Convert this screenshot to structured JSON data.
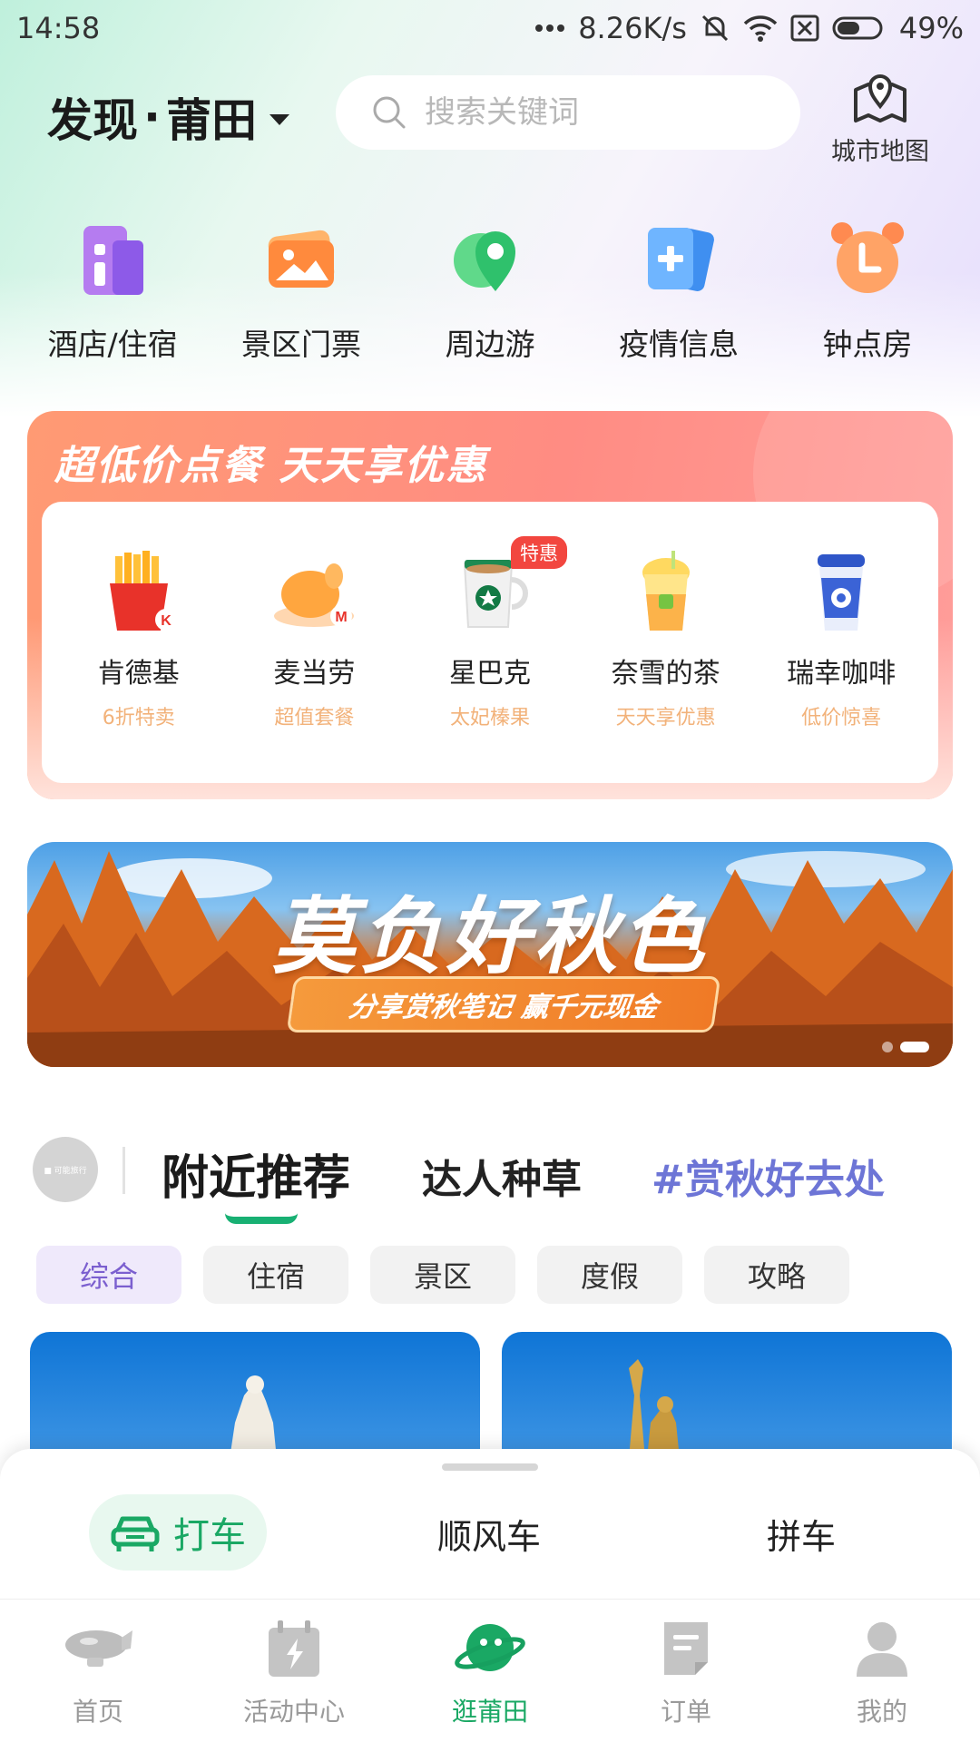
{
  "status_bar": {
    "time": "14:58",
    "net_speed": "8.26K/s",
    "battery": "49%"
  },
  "header": {
    "title_prefix": "发现",
    "title_sep": "·",
    "city": "莆田",
    "search_placeholder": "搜索关键词",
    "city_map_label": "城市地图"
  },
  "quick_nav": [
    {
      "label": "酒店/住宿",
      "icon": "hotel-icon"
    },
    {
      "label": "景区门票",
      "icon": "ticket-icon"
    },
    {
      "label": "周边游",
      "icon": "map-pin-icon"
    },
    {
      "label": "疫情信息",
      "icon": "health-info-icon"
    },
    {
      "label": "钟点房",
      "icon": "alarm-clock-icon"
    }
  ],
  "food": {
    "title": "超低价点餐 天天享优惠",
    "special_tag": "特惠",
    "items": [
      {
        "name": "肯德基",
        "sub": "6折特卖",
        "icon": "kfc-fries-icon"
      },
      {
        "name": "麦当劳",
        "sub": "超值套餐",
        "icon": "mcd-chicken-icon"
      },
      {
        "name": "星巴克",
        "sub": "太妃榛果",
        "icon": "starbucks-cup-icon"
      },
      {
        "name": "奈雪的茶",
        "sub": "天天享优惠",
        "icon": "nayuki-tea-icon"
      },
      {
        "name": "瑞幸咖啡",
        "sub": "低价惊喜",
        "icon": "luckin-coffee-icon"
      }
    ]
  },
  "banner": {
    "title": "莫负好秋色",
    "subtitle": "分享赏秋笔记 赢千元现金"
  },
  "rec_tabs": {
    "avatar_text": "■ 可能旅行",
    "active": "附近推荐",
    "second": "达人种草",
    "third": "#赏秋好去处"
  },
  "chips": [
    "综合",
    "住宿",
    "景区",
    "度假",
    "攻略"
  ],
  "ride": {
    "taxi": "打车",
    "hitch": "顺风车",
    "carpool": "拼车"
  },
  "bottom_nav": [
    {
      "label": "首页",
      "icon": "airship-home-icon"
    },
    {
      "label": "活动中心",
      "icon": "activity-calendar-icon"
    },
    {
      "label": "逛莆田",
      "icon": "planet-explore-icon",
      "active": true
    },
    {
      "label": "订单",
      "icon": "order-doc-icon"
    },
    {
      "label": "我的",
      "icon": "user-profile-icon"
    }
  ],
  "colors": {
    "accent_green": "#1aa864",
    "accent_purple": "#6d75d6",
    "food_orange": "#ff8c83"
  }
}
